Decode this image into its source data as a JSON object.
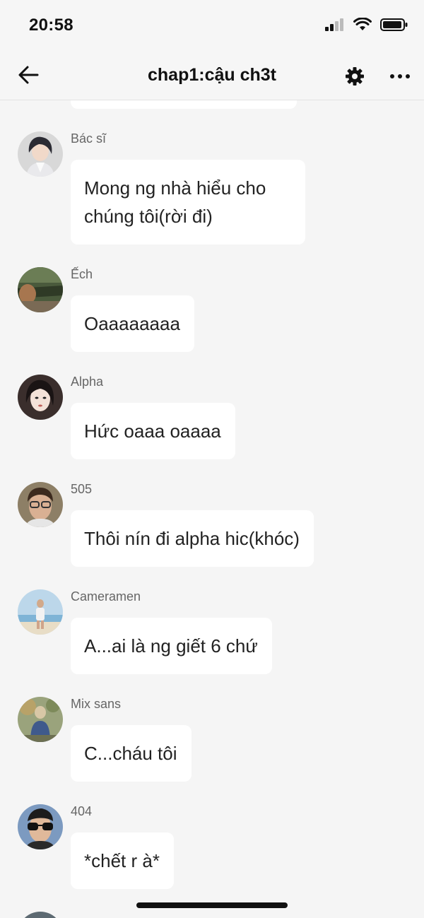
{
  "status_bar": {
    "time": "20:58"
  },
  "header": {
    "title": "chap1:cậu ch3t"
  },
  "messages": [
    {
      "sender": "Bác sĩ",
      "text": "Mong ng nhà hiểu cho\nchúng tôi(rời đi)",
      "avatar_icon": "avatar-icon"
    },
    {
      "sender": "Ếch",
      "text": "Oaaaaaaaa",
      "avatar_icon": "avatar-icon"
    },
    {
      "sender": "Alpha",
      "text": "Hức oaaa oaaaa",
      "avatar_icon": "avatar-icon"
    },
    {
      "sender": "505",
      "text": "Thôi nín đi alpha hic(khóc)",
      "avatar_icon": "avatar-icon"
    },
    {
      "sender": "Cameramen",
      "text": "A...ai là ng giết 6 chứ",
      "avatar_icon": "avatar-icon"
    },
    {
      "sender": "Mix sans",
      "text": "C...cháu tôi",
      "avatar_icon": "avatar-icon"
    },
    {
      "sender": "404",
      "text": "*chết r à*",
      "avatar_icon": "avatar-icon"
    }
  ],
  "colors": {
    "background": "#f5f5f5",
    "bubble": "#ffffff",
    "text": "#222222",
    "sender": "#666666"
  }
}
